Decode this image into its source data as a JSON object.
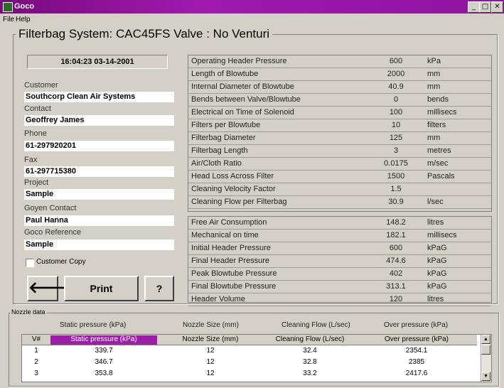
{
  "window": {
    "title": "Goco",
    "min_glyph": "_",
    "max_glyph": "□",
    "close_glyph": "✕"
  },
  "menu": [
    "File",
    "Help"
  ],
  "heading": "Filterbag System: CAC45FS Valve : No Venturi",
  "datetime": "16:04:23   03-14-2001",
  "fields": [
    {
      "label": "Customer",
      "value": "Southcorp Clean Air Systems"
    },
    {
      "label": "Contact",
      "value": "Geoffrey James"
    },
    {
      "label": "Phone",
      "value": "61-297920201"
    },
    {
      "label": "Fax",
      "value": "61-297715380"
    },
    {
      "label": "Project",
      "value": "Sample"
    },
    {
      "label": "Goyen Contact",
      "value": "Paul Hanna"
    },
    {
      "label": "Goco Reference",
      "value": "Sample"
    }
  ],
  "customer_copy": {
    "label": "Customer Copy",
    "checked": false
  },
  "buttons": {
    "back_icon": "arrow-left-icon",
    "back_glyph": "🡐",
    "print": "Print",
    "help": "?"
  },
  "params_top": [
    {
      "name": "Operating Header Pressure",
      "value": "600",
      "unit": "kPa"
    },
    {
      "name": "Length of Blowtube",
      "value": "2000",
      "unit": "mm"
    },
    {
      "name": "Internal Diameter of Blowtube",
      "value": "40.9",
      "unit": "mm"
    },
    {
      "name": "Bends between Valve/Blowtube",
      "value": "0",
      "unit": "bends"
    },
    {
      "name": "Electrical on Time of Solenoid",
      "value": "100",
      "unit": "millisecs"
    },
    {
      "name": "Filters per Blowtube",
      "value": "10",
      "unit": "filters"
    },
    {
      "name": "Filterbag Diameter",
      "value": "125",
      "unit": "mm"
    },
    {
      "name": "Filterbag Length",
      "value": "3",
      "unit": "metres"
    },
    {
      "name": "Air/Cloth Ratio",
      "value": "0.0175",
      "unit": "m/sec"
    },
    {
      "name": "Head Loss Across Filter",
      "value": "1500",
      "unit": "Pascals"
    },
    {
      "name": "Cleaning Velocity Factor",
      "value": "1.5",
      "unit": ""
    },
    {
      "name": "Cleaning Flow per Filterbag",
      "value": "30.9",
      "unit": "l/sec"
    }
  ],
  "params_bottom": [
    {
      "name": "Free Air Consumption",
      "value": "148.2",
      "unit": "litres"
    },
    {
      "name": "Mechanical on time",
      "value": "182.1",
      "unit": "millisecs"
    },
    {
      "name": "Initial Header Pressure",
      "value": "600",
      "unit": "kPaG"
    },
    {
      "name": "Final Header Pressure",
      "value": "474.6",
      "unit": "kPaG"
    },
    {
      "name": "Peak Blowtube Pressure",
      "value": "402",
      "unit": "kPaG"
    },
    {
      "name": "Final Blowtube Pressure",
      "value": "313.1",
      "unit": "kPaG"
    },
    {
      "name": "Header Volume",
      "value": "120",
      "unit": "litres"
    }
  ],
  "nozzle": {
    "group_label": "Nozzle data",
    "headers": [
      "Static pressure (kPa)",
      "Nozzle Size (mm)",
      "Cleaning Flow (L/sec)",
      "Over pressure (kPa)"
    ],
    "grid_headers": [
      "V#",
      "Static pressure (kPa)",
      "Nozzle Size (mm)",
      "Cleaning Flow (L/sec)",
      "Over pressure (kPa)"
    ],
    "rows": [
      [
        "1",
        "339.7",
        "12",
        "32.4",
        "2354.1"
      ],
      [
        "2",
        "346.7",
        "12",
        "32.8",
        "2385"
      ],
      [
        "3",
        "353.8",
        "12",
        "33.2",
        "2417.6"
      ]
    ],
    "highlight_color": "#9b1ea8"
  }
}
